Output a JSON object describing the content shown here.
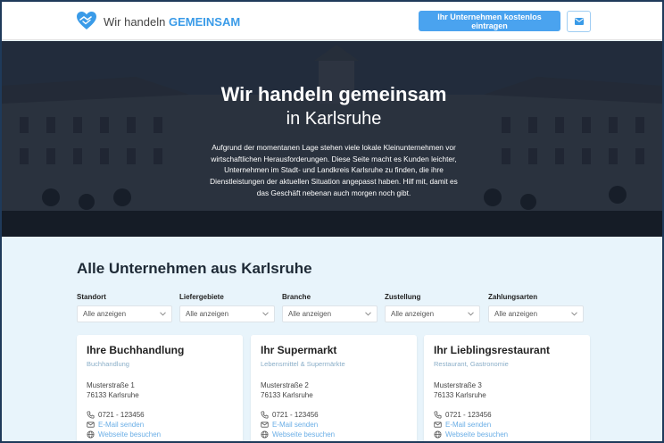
{
  "header": {
    "brand_prefix": "Wir handeln",
    "brand_bold": "GEMEINSAM",
    "cta_label": "Ihr Unternehmen kostenlos eintragen",
    "mail_icon": "envelope-icon",
    "logo_icon": "heart-handshake-icon"
  },
  "hero": {
    "title": "Wir handeln gemeinsam",
    "subtitle": "in Karlsruhe",
    "text": "Aufgrund der momentanen Lage stehen viele lokale Kleinunternehmen vor wirtschaftlichen Herausforderungen. Diese Seite macht es Kunden leichter, Unternehmen im Stadt- und Landkreis Karlsruhe zu finden, die ihre Dienstleistungen der aktuellen Situation angepasst haben. Hilf mit, damit es das Geschäft nebenan auch morgen noch gibt."
  },
  "section": {
    "title": "Alle Unternehmen aus Karlsruhe"
  },
  "filters": [
    {
      "label": "Standort",
      "value": "Alle anzeigen"
    },
    {
      "label": "Liefergebiete",
      "value": "Alle anzeigen"
    },
    {
      "label": "Branche",
      "value": "Alle anzeigen"
    },
    {
      "label": "Zustellung",
      "value": "Alle anzeigen"
    },
    {
      "label": "Zahlungsarten",
      "value": "Alle anzeigen"
    }
  ],
  "cards": [
    {
      "title": "Ihre Buchhandlung",
      "category": "Buchhandlung",
      "street": "Musterstraße 1",
      "city": "76133 Karlsruhe",
      "phone": "0721 - 123456",
      "email": "E-Mail senden",
      "web": "Webseite besuchen"
    },
    {
      "title": "Ihr Supermarkt",
      "category": "Lebensmittel & Supermärkte",
      "street": "Musterstraße 2",
      "city": "76133 Karlsruhe",
      "phone": "0721 - 123456",
      "email": "E-Mail senden",
      "web": "Webseite besuchen"
    },
    {
      "title": "Ihr Lieblingsrestaurant",
      "category": "Restaurant, Gastronomie",
      "street": "Musterstraße 3",
      "city": "76133 Karlsruhe",
      "phone": "0721 - 123456",
      "email": "E-Mail senden",
      "web": "Webseite besuchen"
    }
  ],
  "colors": {
    "accent": "#4aa3ef",
    "link": "#6aaee6",
    "page_bg": "#e8f4fb"
  }
}
